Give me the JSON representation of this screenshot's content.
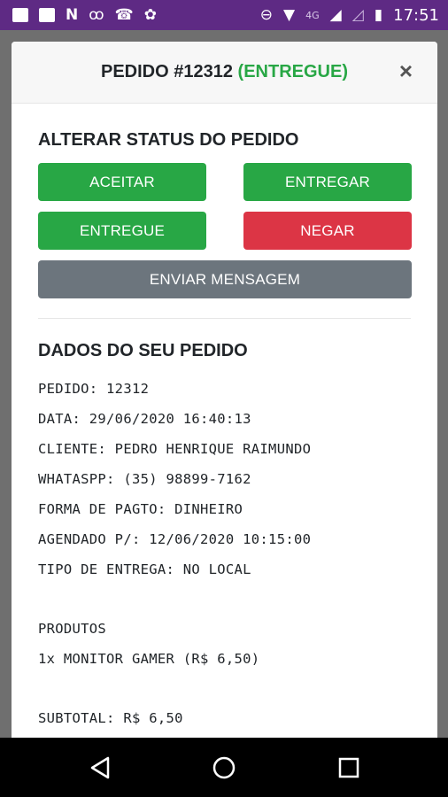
{
  "status_bar": {
    "network": "4G",
    "time": "17:51"
  },
  "modal": {
    "title_prefix": "PEDIDO #12312",
    "title_status": "(ENTREGUE)",
    "close": "×"
  },
  "change_status": {
    "heading": "ALTERAR STATUS DO PEDIDO",
    "accept": "ACEITAR",
    "deliver": "ENTREGAR",
    "delivered": "ENTREGUE",
    "deny": "NEGAR",
    "send_message": "ENVIAR MENSAGEM"
  },
  "order_details": {
    "heading": "DADOS DO SEU PEDIDO",
    "lines": [
      "PEDIDO: 12312",
      "DATA: 29/06/2020 16:40:13",
      "CLIENTE: PEDRO HENRIQUE RAIMUNDO",
      "WHATASPP: (35) 98899-7162",
      "FORMA DE PAGTO: DINHEIRO",
      "AGENDADO P/: 12/06/2020 10:15:00",
      "TIPO DE ENTREGA: NO LOCAL"
    ],
    "products_label": "PRODUTOS",
    "products": [
      "1x MONITOR GAMER (R$ 6,50)"
    ],
    "subtotal": "SUBTOTAL: R$ 6,50"
  },
  "colors": {
    "status_bar": "#5e2a84",
    "success": "#28a745",
    "danger": "#dc3545",
    "secondary": "#6c757d"
  },
  "icons": [
    "message-icon",
    "image-icon",
    "n-icon",
    "voicemail-icon",
    "call-missed-icon",
    "flower-icon",
    "do-not-disturb-icon",
    "wifi-icon",
    "signal-icon",
    "signal-empty-icon",
    "battery-charging-icon",
    "back-icon",
    "home-icon",
    "recents-icon"
  ]
}
